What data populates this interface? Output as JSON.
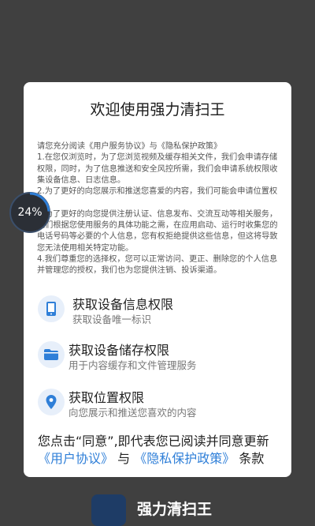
{
  "dialog": {
    "title": "欢迎使用强力清扫王",
    "terms": [
      "请您充分阅读《用户服务协议》与《隐私保护政策》",
      "1.在您仅浏览时，为了您浏览视频及缓存相关文件，我们会申请存储权限，同时，为了信息推送和安全风控所需，我们会申请系统权限收集设备信息、日志信息。",
      "2.为了更好的向您展示和推送您喜爱的内容，我们可能会申请位置权限。",
      "3.为了更好的向您提供注册认证、信息发布、交流互动等相关服务，我们根据您使用服务的具体功能之需，在应用启动、运行时收集您的电话号码等必要的个人信息，您有权拒绝提供这些信息，但这将导致您无法使用相关特定功能。",
      "4.我们尊重您的选择权，您可以正常访问、更正、删除您的个人信息并管理您的授权，我们也为您提供注销、投诉渠道。"
    ],
    "permissions": [
      {
        "icon": "phone-icon",
        "title": "获取设备信息权限",
        "desc": "获取设备唯一标识"
      },
      {
        "icon": "folder-icon",
        "title": "获取设备储存权限",
        "desc": "用于内容缓存和文件管理服务"
      },
      {
        "icon": "location-pin-icon",
        "title": "获取位置权限",
        "desc": "向您展示和推送您喜欢的内容"
      }
    ],
    "consent": {
      "prefix": "您点击“同意”,即代表您已阅读并同意更新",
      "link1": "《用户协议》",
      "mid": "与",
      "link2": "《隐私保护政策》",
      "suffix": "条款"
    }
  },
  "progress_badge": {
    "label": "24%",
    "value": 0.24
  },
  "footer": {
    "app_name": "强力清扫王"
  },
  "colors": {
    "accent": "#2f7fd8",
    "icon_bg": "#e7effa",
    "backdrop": "#404040"
  }
}
